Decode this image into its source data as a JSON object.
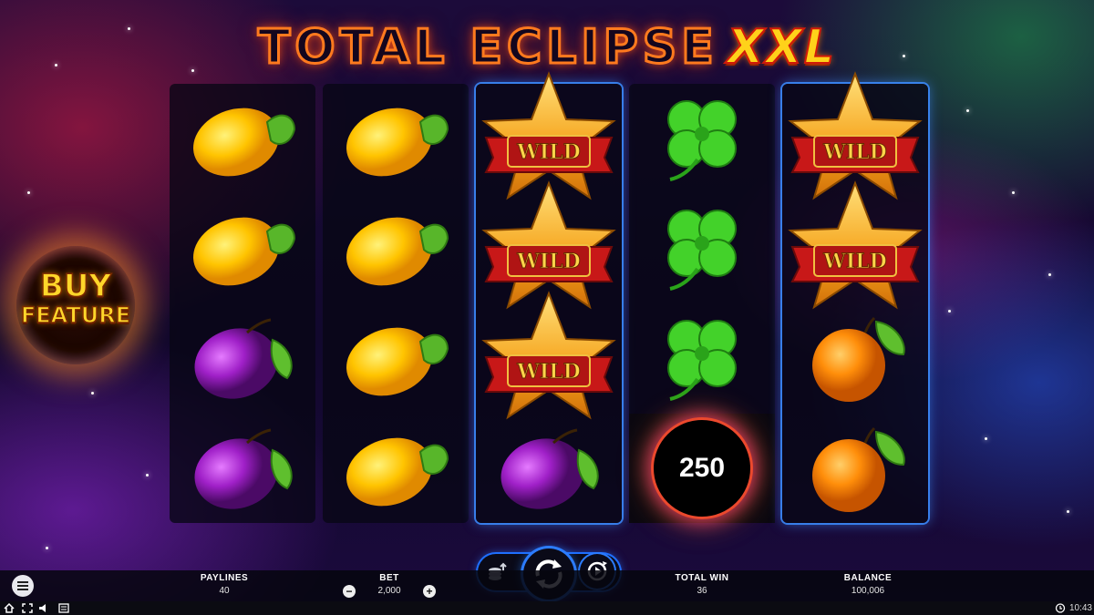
{
  "title": {
    "main": "TOTAL ECLIPSE",
    "suffix": "XXL"
  },
  "buy_feature": {
    "line1": "BUY",
    "line2": "FEATURE"
  },
  "reels": [
    [
      "lemon",
      "lemon",
      "plum",
      "plum"
    ],
    [
      "lemon",
      "lemon",
      "lemon",
      "lemon"
    ],
    [
      "wild-star",
      "wild-star",
      "wild-star",
      "plum"
    ],
    [
      "clover",
      "clover",
      "clover",
      "number-disc"
    ],
    [
      "wild-star",
      "wild-star",
      "orange",
      "orange"
    ]
  ],
  "wild_label": "WILD",
  "bonus_value": "250",
  "bar": {
    "paylines_label": "PAYLINES",
    "paylines_value": "40",
    "bet_label": "BET",
    "bet_value": "2,000",
    "bet_minus": "−",
    "bet_plus": "+",
    "total_win_label": "TOTAL WIN",
    "total_win_value": "36",
    "balance_label": "BALANCE",
    "balance_value": "100,006"
  },
  "clock": "10:43",
  "colors": {
    "reel_frame": "#3c8cff",
    "title_outline": "#ff7a1e",
    "xxl": "#ffd21a"
  }
}
